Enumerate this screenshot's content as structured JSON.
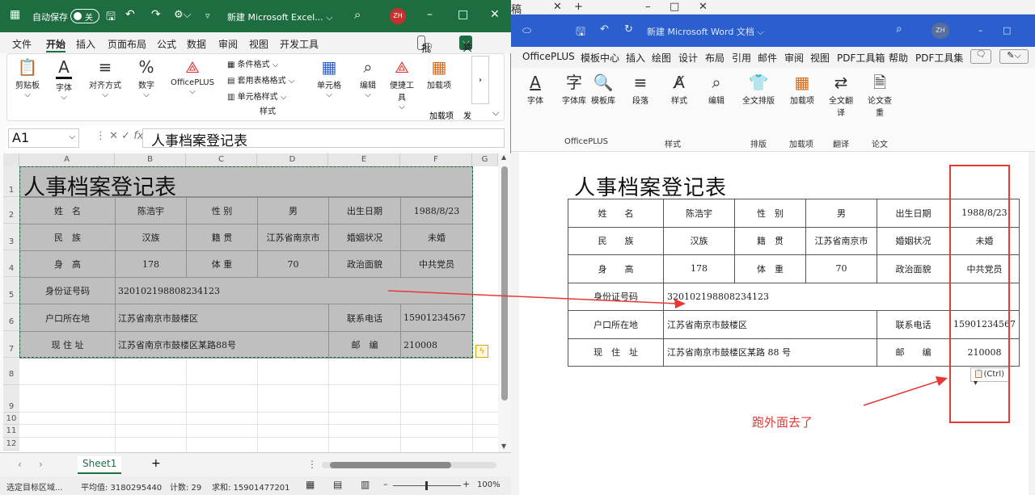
{
  "background_window": {
    "text_fragment": "稿",
    "close": "✕",
    "new_tab": "+",
    "minimize": "–",
    "maximize": "□",
    "close2": "✕"
  },
  "word": {
    "title": "新建 Microsoft Word 文档 ⌵",
    "avatar": "ZH",
    "tabs": [
      "OfficePLUS",
      "模板中心",
      "插入",
      "绘图",
      "设计",
      "布局",
      "引用",
      "邮件",
      "审阅",
      "视图",
      "PDF工具箱",
      "帮助",
      "PDF工具集"
    ],
    "ribbon_items": [
      "字体",
      "字体库",
      "模板库",
      "段落",
      "样式",
      "编辑",
      "全文排版",
      "加载项",
      "全文翻译",
      "论文查重"
    ],
    "group_labels": [
      "OfficePLUS",
      "样式",
      "排版",
      "加载项",
      "翻译",
      "论文"
    ],
    "doc_title": "人事档案登记表",
    "table": [
      [
        "姓　　名",
        "陈浩宇",
        "性　别",
        "男",
        "出生日期",
        "1988/8/23"
      ],
      [
        "民　　族",
        "汉族",
        "籍　贯",
        "江苏省南京市",
        "婚姻状况",
        "未婚"
      ],
      [
        "身　　高",
        "178",
        "体　重",
        "70",
        "政治面貌",
        "中共党员"
      ],
      [
        "身份证号码",
        "320102198808234123"
      ],
      [
        "户口所在地",
        "江苏省南京市鼓楼区",
        "联系电话",
        "15901234567"
      ],
      [
        "现　住　址",
        "江苏省南京市鼓楼区某路 88 号",
        "邮　　编",
        "210008"
      ]
    ],
    "paste_ctrl": "(Ctrl) ▾",
    "annotation": "跑外面去了"
  },
  "excel": {
    "autosave_label": "自动保存",
    "autosave_state": "关",
    "title": "新建 Microsoft Excel... ⌵",
    "avatar": "ZH",
    "tabs": [
      "文件",
      "开始",
      "插入",
      "页面布局",
      "公式",
      "数据",
      "审阅",
      "视图",
      "开发工具"
    ],
    "comment_btn": "批注",
    "share_btn": "共享",
    "ribbon": {
      "clipboard": "剪贴板",
      "font": "字体",
      "align": "对齐方式",
      "number": "数字",
      "officeplus": "OfficePLUS",
      "cond_format": "条件格式 ⌵",
      "table_format": "套用表格格式 ⌵",
      "cell_style": "单元格样式 ⌵",
      "styles_group": "样式",
      "cells": "单元格",
      "edit": "编辑",
      "quick": "便捷工具",
      "addins": "加载项",
      "addins_group": "加载项",
      "more_group": "发"
    },
    "namebox": "A1",
    "formula": "人事档案登记表",
    "columns": [
      "A",
      "B",
      "C",
      "D",
      "E",
      "F",
      "G"
    ],
    "rows": [
      "1",
      "2",
      "3",
      "4",
      "5",
      "6",
      "7",
      "8",
      "9",
      "10",
      "11",
      "12"
    ],
    "sheet_title": "人事档案登记表",
    "table": [
      [
        "姓　名",
        "陈浩宇",
        "性 别",
        "男",
        "出生日期",
        "1988/8/23"
      ],
      [
        "民　族",
        "汉族",
        "籍 贯",
        "江苏省南京市",
        "婚姻状况",
        "未婚"
      ],
      [
        "身　高",
        "178",
        "体 重",
        "70",
        "政治面貌",
        "中共党员"
      ],
      [
        "身份证号码",
        "320102198808234123"
      ],
      [
        "户口所在地",
        "江苏省南京市鼓楼区",
        "联系电话",
        "15901234567"
      ],
      [
        "现 住 址",
        "江苏省南京市鼓楼区某路88号",
        "邮　编",
        "210008"
      ]
    ],
    "sheet_tab": "Sheet1",
    "add_sheet": "+",
    "status": {
      "mode": "选定目标区域...",
      "avg": "平均值: 3180295440",
      "count": "计数: 29",
      "sum": "求和: 15901477201",
      "zoom": "100%"
    }
  },
  "colors": {
    "excel_green": "#1d6d40",
    "word_blue": "#2b5fce",
    "annotation_red": "#e53935"
  }
}
